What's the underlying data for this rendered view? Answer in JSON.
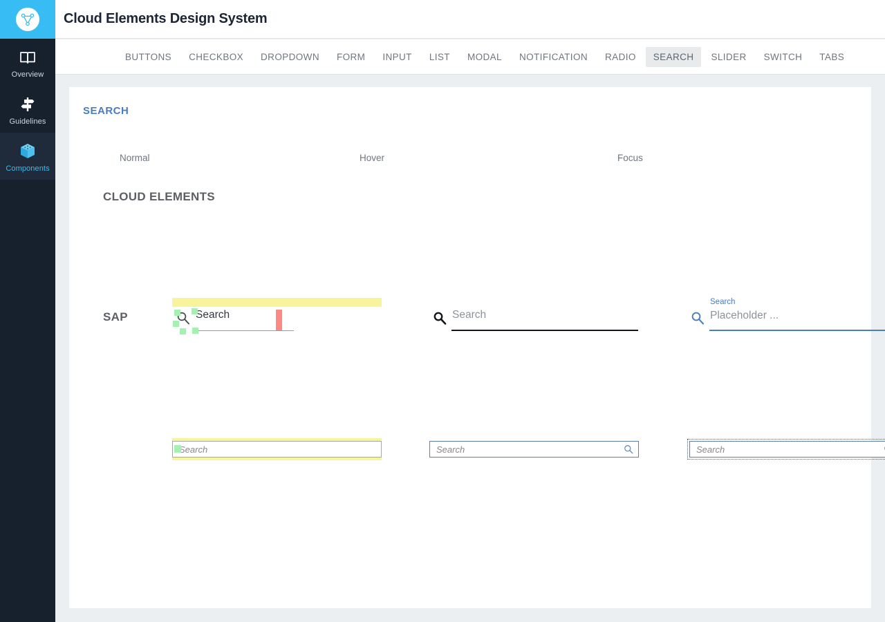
{
  "header": {
    "title": "Cloud Elements Design System",
    "logo_icon": "cloud-elements-logo-icon"
  },
  "sidebar": {
    "items": [
      {
        "label": "Overview",
        "icon": "book-icon",
        "active": false
      },
      {
        "label": "Guidelines",
        "icon": "signpost-icon",
        "active": false
      },
      {
        "label": "Components",
        "icon": "cube-icon",
        "active": true
      }
    ]
  },
  "tabs": [
    {
      "label": "BUTTONS",
      "active": false
    },
    {
      "label": "CHECKBOX",
      "active": false
    },
    {
      "label": "DROPDOWN",
      "active": false
    },
    {
      "label": "FORM",
      "active": false
    },
    {
      "label": "INPUT",
      "active": false
    },
    {
      "label": "LIST",
      "active": false
    },
    {
      "label": "MODAL",
      "active": false
    },
    {
      "label": "NOTIFICATION",
      "active": false
    },
    {
      "label": "RADIO",
      "active": false
    },
    {
      "label": "SEARCH",
      "active": true
    },
    {
      "label": "SLIDER",
      "active": false
    },
    {
      "label": "SWITCH",
      "active": false
    },
    {
      "label": "TABS",
      "active": false
    }
  ],
  "main": {
    "section_title": "SEARCH",
    "columns": [
      "Normal",
      "Hover",
      "Focus"
    ],
    "groups": [
      {
        "name": "CLOUD ELEMENTS",
        "variants": {
          "normal": {
            "text": "Search",
            "icon": "search-icon"
          },
          "hover": {
            "text": "Search",
            "icon": "search-icon"
          },
          "focus": {
            "label": "Search",
            "text": "Placeholder ...",
            "icon": "search-icon"
          }
        }
      },
      {
        "name": "SAP",
        "variants": {
          "normal": {
            "text": "Search"
          },
          "hover": {
            "text": "Search",
            "icon": "search-icon"
          },
          "focus": {
            "text": "Search",
            "icon": "search-icon"
          }
        }
      }
    ]
  },
  "colors": {
    "brand_cyan": "#37bdf4",
    "sidebar_dark": "#17212e",
    "section_blue": "#4a7cbf",
    "page_bg": "#eceff1",
    "highlight_yellow": "#f7f49b",
    "handle_green": "#a6f0b4",
    "marker_red": "#fa8a82",
    "sap_border_blue": "#5a7fae"
  }
}
